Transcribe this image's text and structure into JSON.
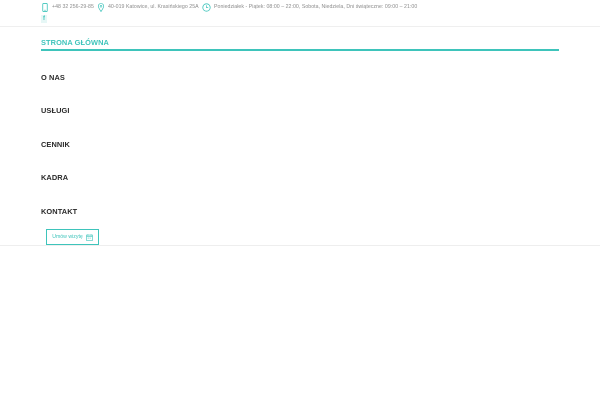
{
  "topbar": {
    "phone": "+48 32 256-29-85",
    "address": "40-019 Katowice, ul. Krasińskiego 25A",
    "hours": "Poniedziałek - Piątek: 08:00 – 22:00, Sobota, Niedziela, Dni świąteczne: 09:00 – 21:00",
    "social_label": "f",
    "icons": [
      "phone-icon",
      "map-pin-icon",
      "clock-icon",
      "facebook-icon"
    ]
  },
  "nav": {
    "home": "STRONA GŁÓWNA",
    "items": [
      "O NAS",
      "USŁUGI",
      "CENNIK",
      "KADRA",
      "KONTAKT"
    ]
  },
  "cta": {
    "label": "Umów wizytę",
    "icon": "calendar-icon"
  },
  "colors": {
    "accent": "#3ec4bb",
    "text": "#2a2a2a",
    "muted": "#8a8a8a"
  }
}
